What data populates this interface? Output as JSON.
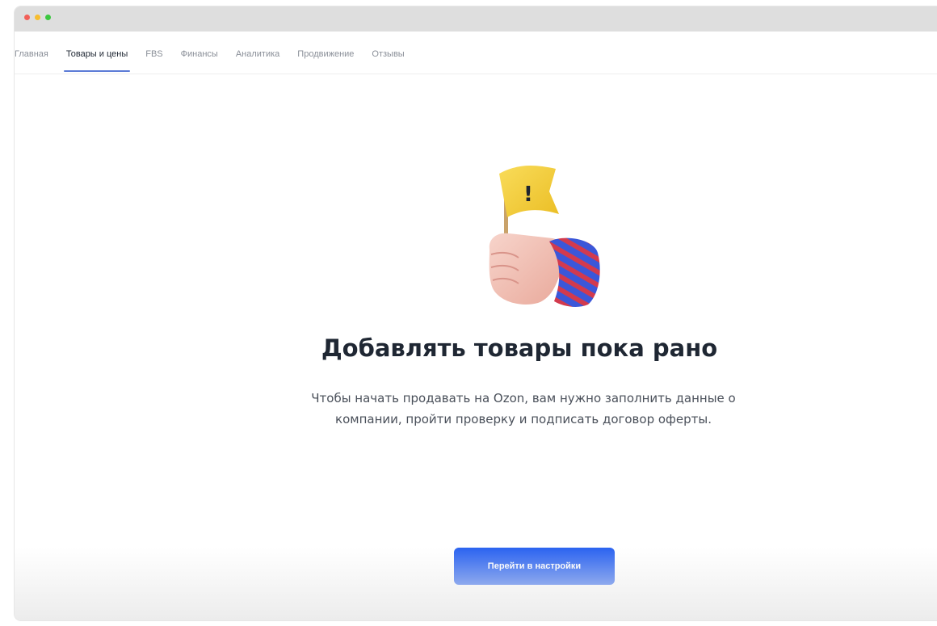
{
  "window": {
    "controls": [
      {
        "name": "close",
        "color": "#f25f58"
      },
      {
        "name": "minimize",
        "color": "#f7bd2f"
      },
      {
        "name": "maximize",
        "color": "#3cc840"
      }
    ]
  },
  "nav": {
    "tabs": [
      {
        "label": "Главная",
        "active": false
      },
      {
        "label": "Товары и цены",
        "active": true
      },
      {
        "label": "FBS",
        "active": false
      },
      {
        "label": "Финансы",
        "active": false
      },
      {
        "label": "Аналитика",
        "active": false
      },
      {
        "label": "Продвижение",
        "active": false
      },
      {
        "label": "Отзывы",
        "active": false
      }
    ]
  },
  "empty_state": {
    "illustration": "hand-holding-warning-flag",
    "flag_mark": "!",
    "title": "Добавлять товары пока рано",
    "description": "Чтобы начать продавать на Ozon, вам нужно заполнить данные о компании, пройти проверку и подписать договор оферты.",
    "button_label": "Перейти в настройки"
  },
  "colors": {
    "accent": "#2b63f0",
    "flag": "#f4cf3b",
    "sleeve_blue": "#3b57d9",
    "sleeve_red": "#d23a4e"
  }
}
